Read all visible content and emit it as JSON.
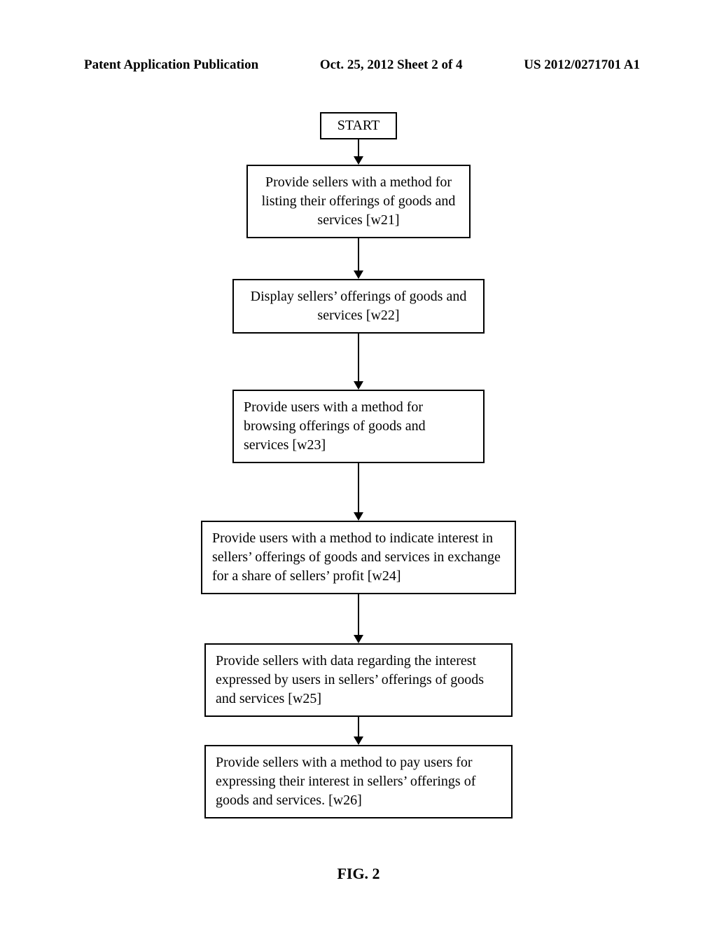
{
  "header": {
    "left": "Patent Application Publication",
    "center": "Oct. 25, 2012  Sheet 2 of 4",
    "right": "US 2012/0271701 A1"
  },
  "chart_data": {
    "type": "flowchart",
    "direction": "top-to-bottom",
    "nodes": [
      {
        "id": "start",
        "label": "START"
      },
      {
        "id": "w21",
        "label": "Provide sellers with a method for listing their offerings of goods and services [w21]"
      },
      {
        "id": "w22",
        "label": "Display sellers’ offerings of goods and services [w22]"
      },
      {
        "id": "w23",
        "label": "Provide users with a method for browsing offerings of goods and services [w23]"
      },
      {
        "id": "w24",
        "label": "Provide users with a method to indicate interest in sellers’ offerings of goods and services in exchange for a share of sellers’ profit [w24]"
      },
      {
        "id": "w25",
        "label": "Provide sellers with data regarding the interest expressed by users in sellers’ offerings of goods and services [w25]"
      },
      {
        "id": "w26",
        "label": "Provide sellers with a method to pay users for expressing their interest in sellers’ offerings of goods and services. [w26]"
      }
    ],
    "edges": [
      [
        "start",
        "w21"
      ],
      [
        "w21",
        "w22"
      ],
      [
        "w22",
        "w23"
      ],
      [
        "w23",
        "w24"
      ],
      [
        "w24",
        "w25"
      ],
      [
        "w25",
        "w26"
      ]
    ]
  },
  "caption": "FIG. 2"
}
